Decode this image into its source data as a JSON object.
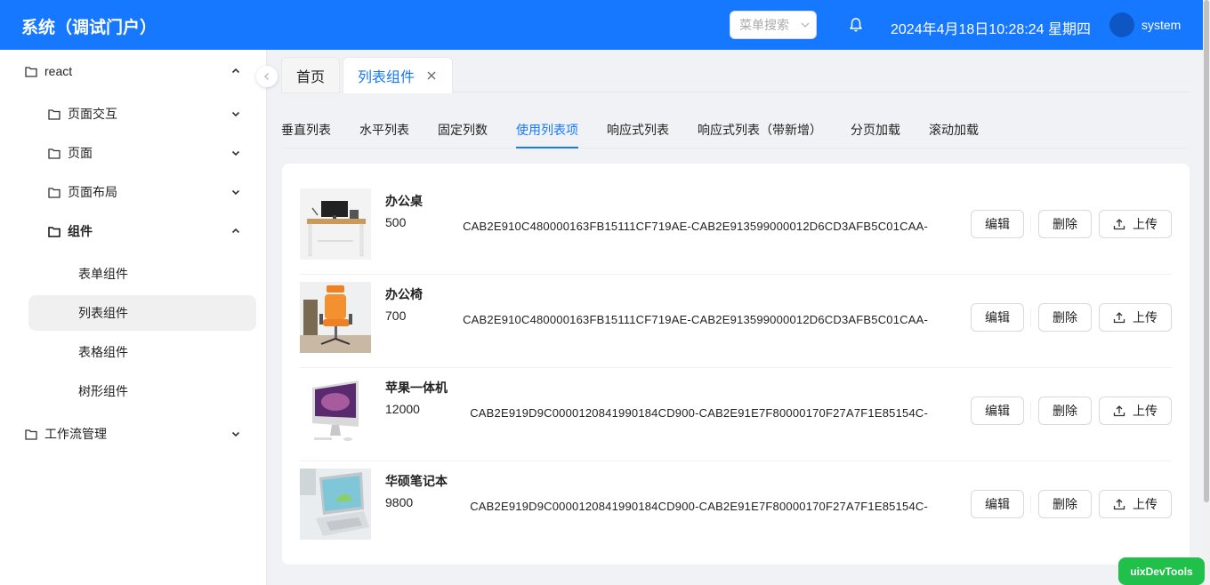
{
  "header": {
    "title": "系统（调试门户）",
    "search_placeholder": "菜单搜索",
    "datetime": "2024年4月18日10:28:24 星期四",
    "username": "system",
    "color": "#1677ff"
  },
  "sidebar": {
    "items": [
      {
        "label": "react",
        "icon": "folder-icon",
        "caret": "up"
      },
      {
        "label": "页面交互",
        "icon": "folder-icon",
        "caret": "down"
      },
      {
        "label": "页面",
        "icon": "folder-icon",
        "caret": "down"
      },
      {
        "label": "页面布局",
        "icon": "folder-icon",
        "caret": "down"
      },
      {
        "label": "组件",
        "icon": "folder-icon",
        "caret": "up"
      },
      {
        "label": "表单组件"
      },
      {
        "label": "列表组件",
        "selected": true
      },
      {
        "label": "表格组件"
      },
      {
        "label": "树形组件"
      },
      {
        "label": "工作流管理",
        "icon": "folder-icon",
        "caret": "down"
      }
    ]
  },
  "page_tabs": [
    {
      "label": "首页"
    },
    {
      "label": "列表组件",
      "active": true,
      "closable": true
    }
  ],
  "sub_tabs": [
    {
      "label": "垂直列表"
    },
    {
      "label": "水平列表"
    },
    {
      "label": "固定列数"
    },
    {
      "label": "使用列表项",
      "active": true
    },
    {
      "label": "响应式列表"
    },
    {
      "label": "响应式列表（带新增）"
    },
    {
      "label": "分页加载"
    },
    {
      "label": "滚动加载"
    }
  ],
  "list": {
    "buttons": {
      "edit": "编辑",
      "delete": "删除",
      "upload": "上传"
    },
    "items": [
      {
        "name": "办公桌",
        "price": "500",
        "code": "CAB2E910C480000163FB15111CF719AE-CAB2E913599000012D6CD3AFB5C01CAA-"
      },
      {
        "name": "办公椅",
        "price": "700",
        "code": "CAB2E910C480000163FB15111CF719AE-CAB2E913599000012D6CD3AFB5C01CAA-"
      },
      {
        "name": "苹果一体机",
        "price": "12000",
        "code": "CAB2E919D9C0000120841990184CD900-CAB2E91E7F80000170F27A7F1E85154C-"
      },
      {
        "name": "华硕笔记本",
        "price": "9800",
        "code": "CAB2E919D9C0000120841990184CD900-CAB2E91E7F80000170F27A7F1E85154C-"
      }
    ]
  },
  "devtools_label": "uixDevTools"
}
